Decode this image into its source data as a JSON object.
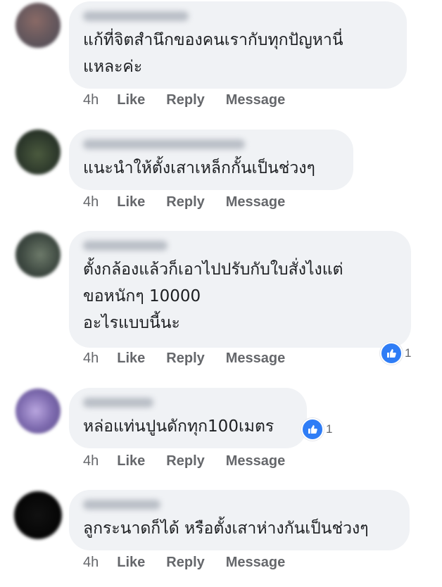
{
  "colors": {
    "bubble": "#f0f2f5",
    "text": "#1c1e21",
    "meta": "#65676b",
    "like": "#2f7df6"
  },
  "comments": [
    {
      "lines": [
        "แก้ที่จิตสำนึกของคนเรากับทุกปัญหานี่",
        "แหละค่ะ"
      ],
      "time": "4h",
      "like_label": "Like",
      "reply_label": "Reply",
      "message_label": "Message"
    },
    {
      "lines": [
        "แนะนำให้ตั้งเสาเหล็กกั้นเป็นช่วงๆ"
      ],
      "time": "4h",
      "like_label": "Like",
      "reply_label": "Reply",
      "message_label": "Message"
    },
    {
      "lines": [
        "ตั้งกล้องแล้วก็เอาไปปรับกับใบสั่งไงแต่",
        "ขอหนักๆ 10000",
        "อะไรแบบนี้นะ"
      ],
      "time": "4h",
      "like_label": "Like",
      "reply_label": "Reply",
      "message_label": "Message",
      "reactions": "1"
    },
    {
      "lines": [
        "หล่อแท่นปูนดักทุก100เมตร"
      ],
      "time": "4h",
      "like_label": "Like",
      "reply_label": "Reply",
      "message_label": "Message",
      "reactions": "1"
    },
    {
      "lines": [
        "ลูกระนาดก็ได้ หรือตั้งเสาห่างกันเป็นช่วงๆ"
      ],
      "time": "4h",
      "like_label": "Like",
      "reply_label": "Reply",
      "message_label": "Message"
    }
  ]
}
